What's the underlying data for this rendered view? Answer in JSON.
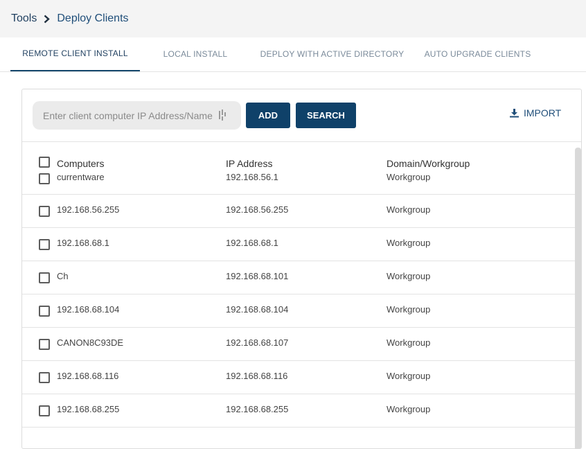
{
  "breadcrumb": {
    "root": "Tools",
    "current": "Deploy Clients"
  },
  "tabs": [
    {
      "label": "REMOTE CLIENT INSTALL",
      "active": true
    },
    {
      "label": "LOCAL INSTALL",
      "active": false
    },
    {
      "label": "DEPLOY WITH ACTIVE DIRECTORY",
      "active": false
    },
    {
      "label": "AUTO UPGRADE CLIENTS",
      "active": false
    }
  ],
  "search": {
    "placeholder": "Enter client computer IP Address/Name",
    "value": ""
  },
  "buttons": {
    "add": "ADD",
    "search": "SEARCH",
    "import": "IMPORT"
  },
  "table": {
    "headers": {
      "computers": "Computers",
      "ip": "IP Address",
      "domain": "Domain/Workgroup"
    },
    "rows": [
      {
        "name": "currentware",
        "ip": "192.168.56.1",
        "domain": "Workgroup"
      },
      {
        "name": "192.168.56.255",
        "ip": "192.168.56.255",
        "domain": "Workgroup"
      },
      {
        "name": "192.168.68.1",
        "ip": "192.168.68.1",
        "domain": "Workgroup"
      },
      {
        "name": "Ch",
        "ip": "192.168.68.101",
        "domain": "Workgroup"
      },
      {
        "name": "192.168.68.104",
        "ip": "192.168.68.104",
        "domain": "Workgroup"
      },
      {
        "name": "CANON8C93DE",
        "ip": "192.168.68.107",
        "domain": "Workgroup"
      },
      {
        "name": "192.168.68.116",
        "ip": "192.168.68.116",
        "domain": "Workgroup"
      },
      {
        "name": "192.168.68.255",
        "ip": "192.168.68.255",
        "domain": "Workgroup"
      }
    ]
  },
  "colors": {
    "primary": "#0f4169",
    "accent_text": "#1f4e79",
    "header_bg": "#f4f4f4"
  }
}
